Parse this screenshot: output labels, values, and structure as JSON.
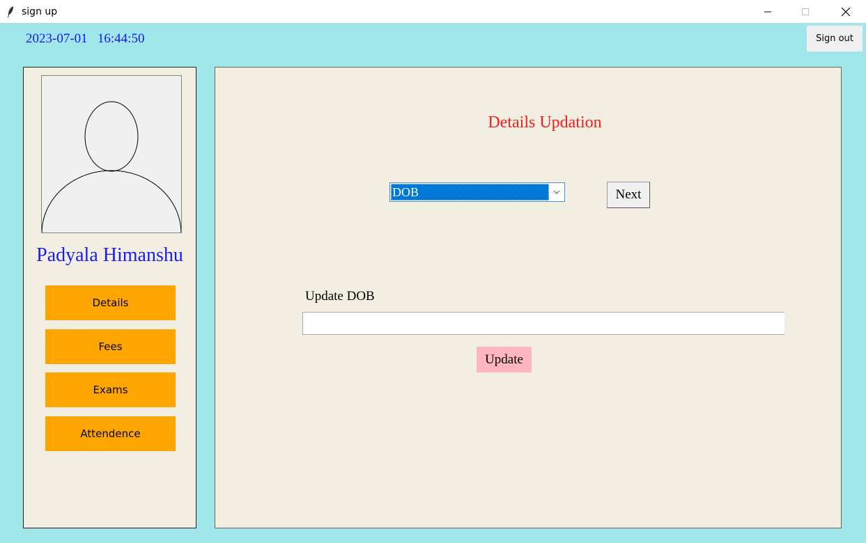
{
  "window": {
    "title": "sign up",
    "icon": "feather-icon",
    "controls": [
      "minimize-icon",
      "maximize-icon",
      "close-icon"
    ]
  },
  "header": {
    "date": "2023-07-01",
    "time": "16:44:50",
    "sign_out_label": "Sign out"
  },
  "sidebar": {
    "avatar_icon": "user-avatar-icon",
    "profile_name": "Padyala Himanshu",
    "nav": [
      {
        "label": "Details"
      },
      {
        "label": "Fees"
      },
      {
        "label": "Exams"
      },
      {
        "label": "Attendence"
      }
    ]
  },
  "main": {
    "title": "Details Updation",
    "field_select": {
      "selected": "DOB"
    },
    "next_label": "Next",
    "update_field_label": "Update DOB",
    "update_input_value": "",
    "update_label": "Update"
  },
  "colors": {
    "background": "#a0e6ea",
    "panel": "#f2efe2",
    "accent_orange": "#ffa500",
    "title_red": "#ff1a1a",
    "name_blue": "#1a1aff",
    "update_pink": "#ffb6c1",
    "select_blue": "#0078d7"
  }
}
